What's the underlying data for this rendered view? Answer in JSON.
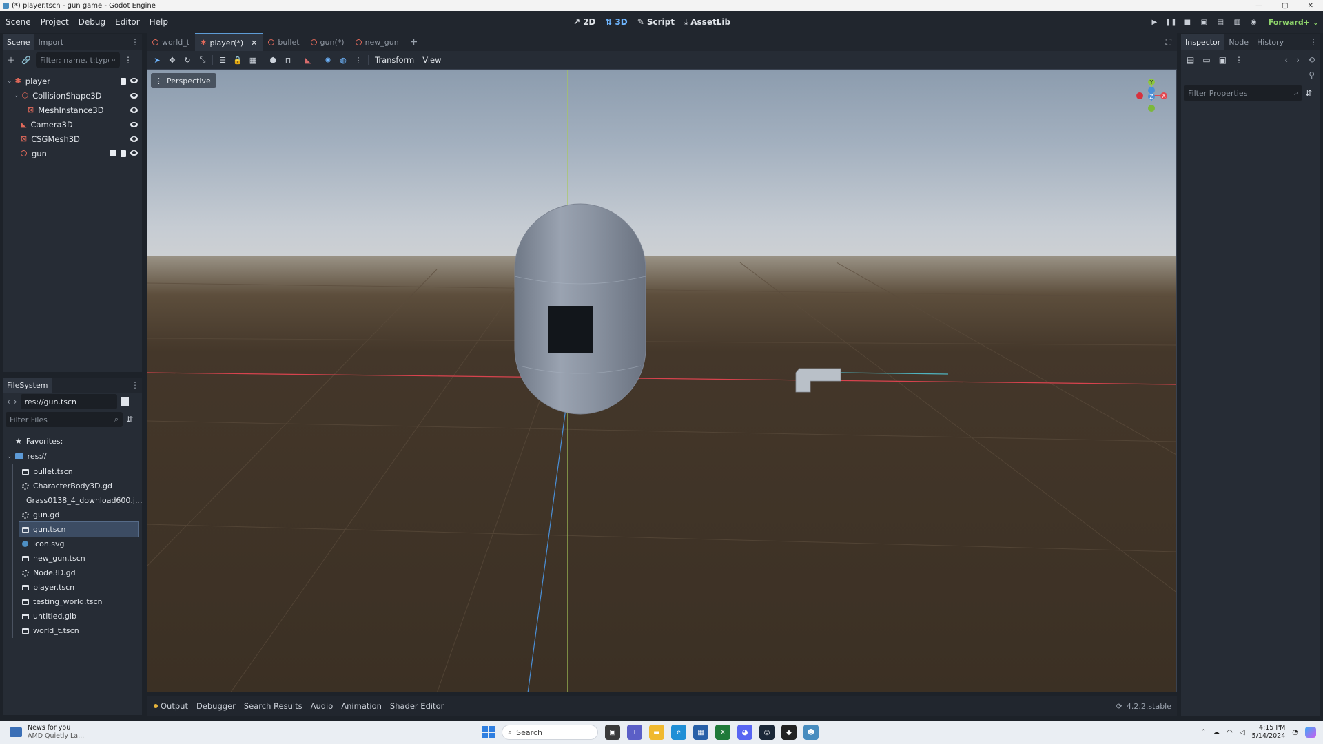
{
  "window": {
    "title": "(*) player.tscn - gun game - Godot Engine"
  },
  "menubar": {
    "items": [
      "Scene",
      "Project",
      "Debug",
      "Editor",
      "Help"
    ]
  },
  "main_screen": {
    "buttons": [
      {
        "label": "2D",
        "icon": "2d-icon",
        "active": false
      },
      {
        "label": "3D",
        "icon": "3d-icon",
        "active": true
      },
      {
        "label": "Script",
        "icon": "script-icon",
        "active": false
      },
      {
        "label": "AssetLib",
        "icon": "assetlib-icon",
        "active": false
      }
    ]
  },
  "renderer": "Forward+",
  "scene_dock": {
    "tabs": [
      "Scene",
      "Import"
    ],
    "active_tab": "Scene",
    "filter_placeholder": "Filter: name, t:type, ...",
    "nodes": [
      {
        "name": "player",
        "icon": "character-body-icon",
        "depth": 0,
        "has_script": true,
        "is_scene": false
      },
      {
        "name": "CollisionShape3D",
        "icon": "collision-shape-icon",
        "depth": 1,
        "has_script": false,
        "is_scene": false
      },
      {
        "name": "MeshInstance3D",
        "icon": "mesh-instance-icon",
        "depth": 2,
        "has_script": false,
        "is_scene": false
      },
      {
        "name": "Camera3D",
        "icon": "camera-icon",
        "depth": 1,
        "has_script": false,
        "is_scene": false
      },
      {
        "name": "CSGMesh3D",
        "icon": "csg-mesh-icon",
        "depth": 1,
        "has_script": false,
        "is_scene": false
      },
      {
        "name": "gun",
        "icon": "node3d-icon",
        "depth": 1,
        "has_script": true,
        "is_scene": true
      }
    ]
  },
  "filesystem_dock": {
    "title": "FileSystem",
    "path": "res://gun.tscn",
    "filter_placeholder": "Filter Files",
    "favorites_label": "Favorites:",
    "root_label": "res://",
    "files": [
      {
        "name": "bullet.tscn",
        "type": "scene",
        "selected": false
      },
      {
        "name": "CharacterBody3D.gd",
        "type": "script",
        "selected": false
      },
      {
        "name": "Grass0138_4_download600.j...",
        "type": "image",
        "selected": false
      },
      {
        "name": "gun.gd",
        "type": "script",
        "selected": false
      },
      {
        "name": "gun.tscn",
        "type": "scene",
        "selected": true
      },
      {
        "name": "icon.svg",
        "type": "svg",
        "selected": false
      },
      {
        "name": "new_gun.tscn",
        "type": "scene",
        "selected": false
      },
      {
        "name": "Node3D.gd",
        "type": "script",
        "selected": false
      },
      {
        "name": "player.tscn",
        "type": "scene",
        "selected": false
      },
      {
        "name": "testing_world.tscn",
        "type": "scene",
        "selected": false
      },
      {
        "name": "untitled.glb",
        "type": "glb",
        "selected": false
      },
      {
        "name": "world_t.tscn",
        "type": "scene",
        "selected": false
      }
    ]
  },
  "editor_tabs": [
    {
      "label": "world_t",
      "active": false
    },
    {
      "label": "player(*)",
      "active": true
    },
    {
      "label": "bullet",
      "active": false
    },
    {
      "label": "gun(*)",
      "active": false
    },
    {
      "label": "new_gun",
      "active": false
    }
  ],
  "viewport_toolbar": {
    "transform_label": "Transform",
    "view_label": "View"
  },
  "viewport": {
    "perspective_label": "Perspective",
    "gizmo_axes": [
      "Y",
      "Z",
      "X"
    ]
  },
  "bottom_panel": {
    "tabs": [
      "Output",
      "Debugger",
      "Search Results",
      "Audio",
      "Animation",
      "Shader Editor"
    ],
    "version": "4.2.2.stable"
  },
  "inspector_dock": {
    "tabs": [
      "Inspector",
      "Node",
      "History"
    ],
    "active_tab": "Inspector",
    "filter_placeholder": "Filter Properties"
  },
  "taskbar": {
    "news_title": "News for you",
    "news_subtitle": "AMD Quietly La...",
    "search_placeholder": "Search",
    "time": "4:15 PM",
    "date": "5/14/2024"
  }
}
